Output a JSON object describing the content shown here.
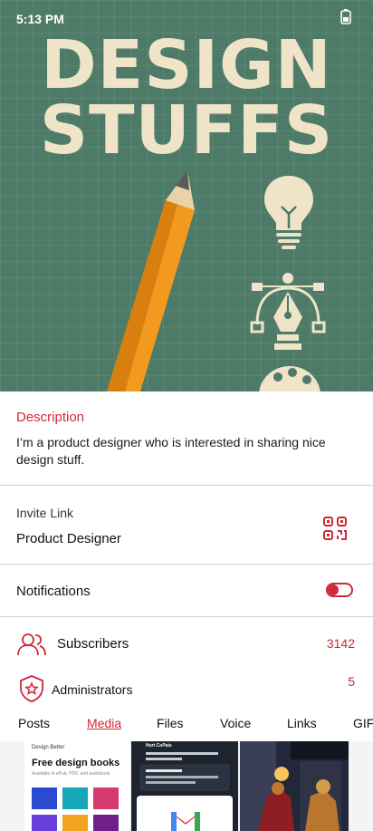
{
  "status_bar": {
    "time": "5:13 PM"
  },
  "hero": {
    "title_line1": "DESIGN",
    "title_line2": "STUFFS"
  },
  "description": {
    "label": "Description",
    "text": "I’m a product designer who is interested in sharing nice design stuff."
  },
  "invite": {
    "label": "Invite Link",
    "value": "Product Designer"
  },
  "notifications": {
    "label": "Notifications",
    "enabled": false
  },
  "subscribers": {
    "label": "Subscribers",
    "count": "3142"
  },
  "administrators": {
    "label": "Administrators",
    "count": "5"
  },
  "tabs": [
    {
      "label": "Posts",
      "active": false
    },
    {
      "label": "Media",
      "active": true
    },
    {
      "label": "Files",
      "active": false
    },
    {
      "label": "Voice",
      "active": false
    },
    {
      "label": "Links",
      "active": false
    },
    {
      "label": "GIF",
      "active": false
    }
  ],
  "media": {
    "thumb1": {
      "brand": "Design Better",
      "headline": "Free design books",
      "sub": "Available in ePub, PDF, and audiobook."
    },
    "thumb2": {
      "name": "Hurt CoPais"
    }
  },
  "colors": {
    "accent": "#d0283a",
    "hero_bg": "#4e7a68",
    "hero_text": "#efe3c8",
    "pencil": "#f29a1f"
  },
  "icons": [
    "battery-icon",
    "lightbulb-icon",
    "pen-tool-icon",
    "palette-icon",
    "qr-code-icon",
    "toggle-icon",
    "subscribers-icon",
    "administrators-icon"
  ]
}
